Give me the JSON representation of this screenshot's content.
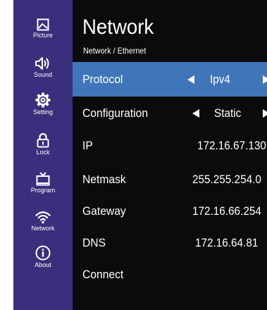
{
  "sidebar": {
    "items": [
      {
        "label": "Picture",
        "icon": "picture-icon"
      },
      {
        "label": "Sound",
        "icon": "speaker-icon"
      },
      {
        "label": "Setting",
        "icon": "gear-icon"
      },
      {
        "label": "Lock",
        "icon": "lock-icon"
      },
      {
        "label": "Program",
        "icon": "tv-icon"
      },
      {
        "label": "Network",
        "icon": "wifi-icon"
      },
      {
        "label": "About",
        "icon": "info-icon"
      }
    ]
  },
  "header": {
    "title": "Network",
    "breadcrumb": "Network / Ethernet"
  },
  "settings": {
    "protocol": {
      "label": "Protocol",
      "value": "Ipv4"
    },
    "configuration": {
      "label": "Configuration",
      "value": "Static"
    },
    "ip": {
      "label": "IP",
      "value": "172.16.67.130"
    },
    "netmask": {
      "label": "Netmask",
      "value": "255.255.254.0"
    },
    "gateway": {
      "label": "Gateway",
      "value": "172.16.66.254"
    },
    "dns": {
      "label": "DNS",
      "value": "172.16.64.81"
    },
    "connect": {
      "label": "Connect"
    }
  },
  "colors": {
    "sidebar": "#3a2f7c",
    "background": "#0b0b0d",
    "selected_row": "#3f76b9",
    "text": "#ffffff"
  }
}
